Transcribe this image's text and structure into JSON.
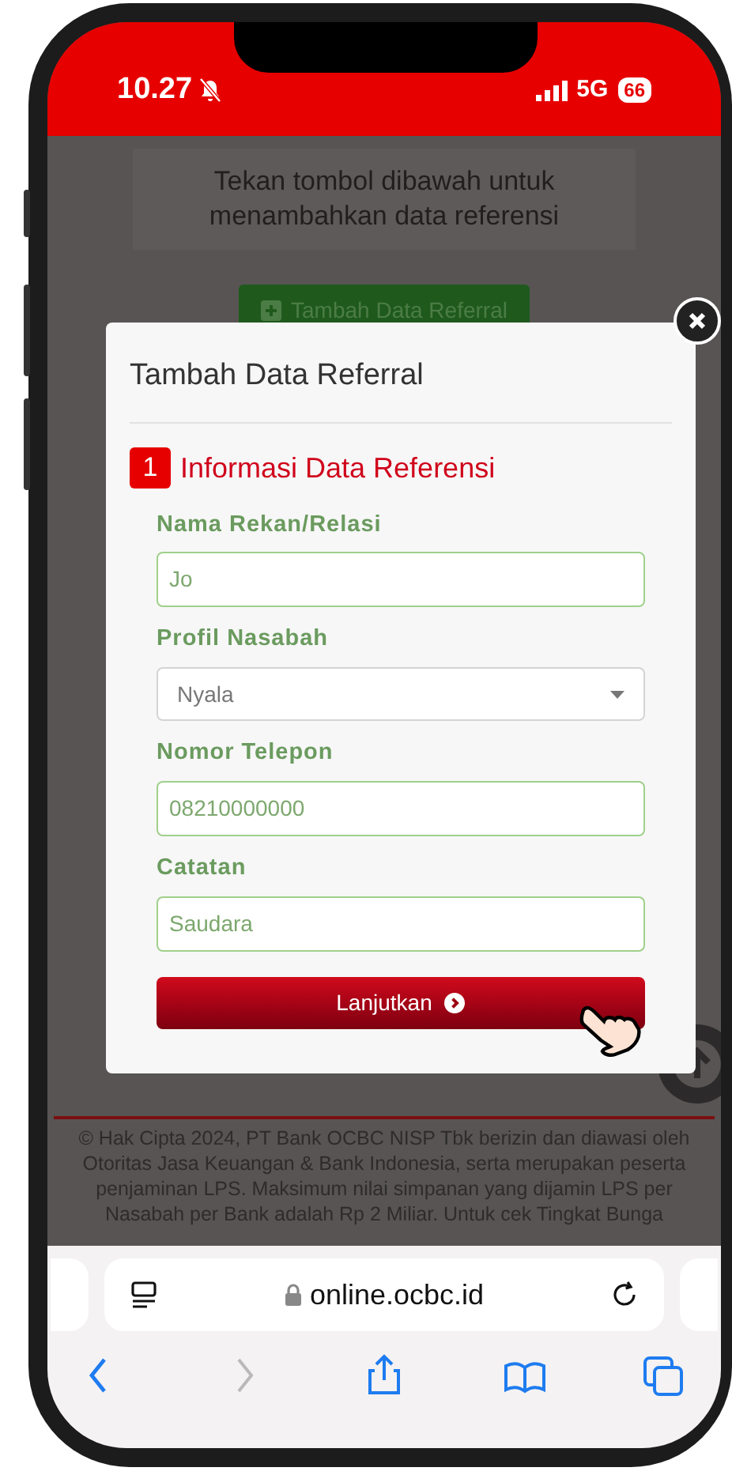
{
  "status_bar": {
    "time": "10.27",
    "network": "5G",
    "battery": "66"
  },
  "page": {
    "info_text": "Tekan tombol dibawah untuk menambahkan data referensi",
    "add_button": "Tambah Data Referral",
    "footer": "© Hak Cipta 2024, PT Bank OCBC NISP Tbk berizin dan diawasi oleh Otoritas Jasa Keuangan & Bank Indonesia, serta merupakan peserta penjaminan LPS. Maksimum nilai simpanan yang dijamin LPS per Nasabah per Bank adalah Rp 2 Miliar. Untuk cek Tingkat Bunga"
  },
  "modal": {
    "title": "Tambah Data Referral",
    "step": {
      "number": "1",
      "title": "Informasi Data Referensi"
    },
    "fields": [
      {
        "label": "Nama Rekan/Relasi",
        "kind": "text",
        "value": "Jo"
      },
      {
        "label": "Profil Nasabah",
        "kind": "select",
        "value": "Nyala"
      },
      {
        "label": "Nomor Telepon",
        "kind": "text",
        "value": "08210000000"
      },
      {
        "label": "Catatan",
        "kind": "text",
        "value": "Saudara"
      }
    ],
    "submit_button": "Lanjutkan"
  },
  "browser": {
    "url": "online.ocbc.id",
    "toolbar": [
      {
        "kind": "back",
        "disabled": false
      },
      {
        "kind": "forward",
        "disabled": true
      },
      {
        "kind": "share",
        "disabled": false
      },
      {
        "kind": "bookmarks",
        "disabled": false
      },
      {
        "kind": "tabs",
        "disabled": false
      }
    ]
  }
}
